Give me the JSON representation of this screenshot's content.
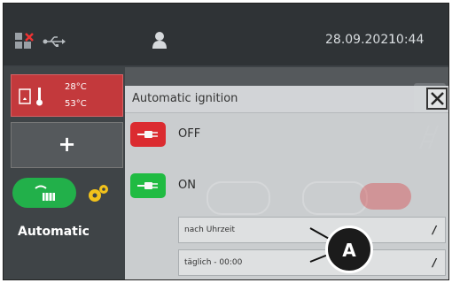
{
  "status_bar": {
    "date": "28.09.2021",
    "time": "10:44",
    "icons": [
      "network-disconnected-icon",
      "usb-icon",
      "user-icon"
    ]
  },
  "sidebar": {
    "temperatures": {
      "flow": "28°C",
      "return": "53°C"
    },
    "add_label": "+",
    "mode_label": "Automatic"
  },
  "dialog": {
    "title": "Automatic ignition",
    "options": [
      {
        "label": "OFF",
        "color": "#e12a2f"
      },
      {
        "label": "ON",
        "color": "#1ec041"
      }
    ],
    "fields": [
      {
        "value": "nach Uhrzeit"
      },
      {
        "value": "täglich - 00:00"
      }
    ],
    "close_icon": "close-icon",
    "edit_icon": "/"
  },
  "callout": {
    "label": "A"
  }
}
